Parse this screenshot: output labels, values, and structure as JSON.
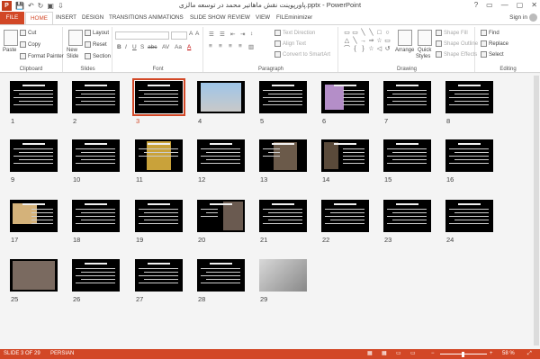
{
  "titlebar": {
    "app_logo": "P",
    "title": "پاورپوینت نقش ماهاتیر محمد در توسعه مالزی.pptx - PowerPoint",
    "qat_save": "💾",
    "qat_undo": "↶",
    "qat_redo": "↻",
    "qat_present": "▣",
    "qat_more": "⇩",
    "help": "?",
    "restore": "▭",
    "minimize": "—",
    "maximize": "▢",
    "close": "✕"
  },
  "tabs": [
    "FILE",
    "HOME",
    "INSERT",
    "DESIGN",
    "TRANSITIONS",
    "ANIMATIONS",
    "SLIDE SHOW",
    "REVIEW",
    "VIEW",
    "FILEminimizer"
  ],
  "signin": "Sign in",
  "ribbon": {
    "clipboard": {
      "paste": "Paste",
      "cut": "Cut",
      "copy": "Copy",
      "format_painter": "Format Painter",
      "label": "Clipboard"
    },
    "slides": {
      "new_slide": "New",
      "new_slide2": "Slide",
      "layout": "Layout",
      "reset": "Reset",
      "section": "Section",
      "label": "Slides"
    },
    "font": {
      "bold": "B",
      "italic": "I",
      "underline": "U",
      "strike": "S",
      "abc": "abc",
      "spacing": "AV",
      "case": "Aa",
      "color": "A",
      "label": "Font"
    },
    "paragraph": {
      "text_direction": "Text Direction",
      "align_text": "Align Text",
      "convert_smartart": "Convert to SmartArt",
      "label": "Paragraph"
    },
    "drawing": {
      "arrange": "Arrange",
      "quick_styles": "Quick",
      "quick_styles2": "Styles",
      "shape_fill": "Shape Fill",
      "shape_outline": "Shape Outline",
      "shape_effects": "Shape Effects",
      "label": "Drawing"
    },
    "editing": {
      "find": "Find",
      "replace": "Replace",
      "select": "Select",
      "label": "Editing"
    }
  },
  "shape_glyphs": [
    "▭",
    "▭",
    "╲",
    "╲",
    "□",
    "○",
    "△",
    "╲",
    "→",
    "⇒",
    "☆",
    "▭",
    "⌒",
    "{",
    "}",
    "☆",
    "◁",
    "↺"
  ],
  "slides": [
    "1",
    "2",
    "3",
    "4",
    "5",
    "6",
    "7",
    "8",
    "9",
    "10",
    "11",
    "12",
    "13",
    "14",
    "15",
    "16",
    "17",
    "18",
    "19",
    "20",
    "21",
    "22",
    "23",
    "24",
    "25",
    "26",
    "27",
    "28",
    "29"
  ],
  "selected_slide": "3",
  "status": {
    "slide_info": "SLIDE 3 OF 29",
    "language": "PERSIAN",
    "zoom": "58 %"
  },
  "colors": {
    "accent": "#d24726",
    "slide_bg": "#000000"
  }
}
